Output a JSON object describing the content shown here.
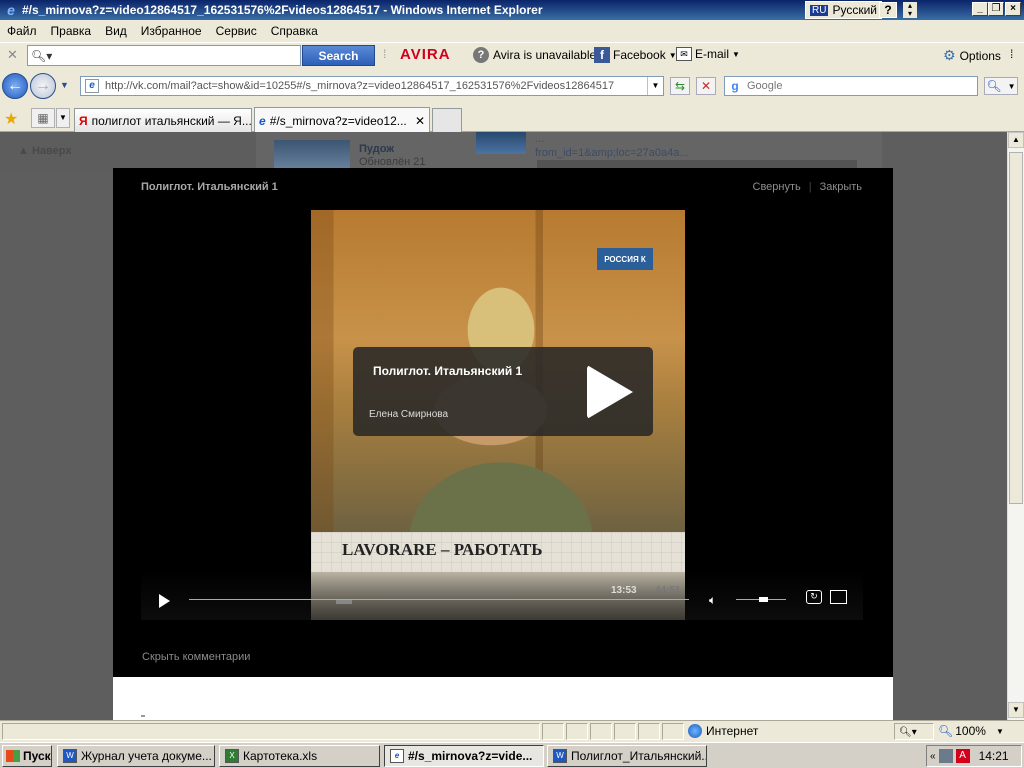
{
  "window": {
    "title": "#/s_mirnova?z=video12864517_162531576%2Fvideos12864517 - Windows Internet Explorer",
    "lang_code": "RU",
    "lang_name": "Русский"
  },
  "menu": [
    "Файл",
    "Правка",
    "Вид",
    "Избранное",
    "Сервис",
    "Справка"
  ],
  "search_toolbar": {
    "search_button": "Search",
    "avira_brand": "AVIRA",
    "avira_status": "Avira is unavailable",
    "facebook": "Facebook",
    "email": "E-mail",
    "options": "Options"
  },
  "address_bar": {
    "url": "http://vk.com/mail?act=show&id=10255#/s_mirnova?z=video12864517_162531576%2Fvideos12864517",
    "google_placeholder": "Google"
  },
  "tabs": [
    {
      "label": "полиглот итальянский — Я...",
      "active": false
    },
    {
      "label": "#/s_mirnova?z=video12...",
      "active": true
    }
  ],
  "background_page": {
    "up_link": "Наверх",
    "group_name": "Пудож",
    "group_updated": "Обновлён 21",
    "link_text_line1": "...",
    "link_text_line2": "from_id=1&amp;loc=27a0a4a..."
  },
  "video": {
    "title": "Полиглот. Итальянский 1",
    "minimize": "Свернуть",
    "close": "Закрыть",
    "channel_logo": "РОССИЯ К",
    "subtitle_text": "LAVORARE – РАБОТАТЬ",
    "info_title": "Полиглот. Итальянский 1",
    "info_author": "Елена Смирнова",
    "time_current": "13:53",
    "time_total": "44:51",
    "progress": 0.31,
    "volume": 0.55,
    "hide_comments": "Скрыть комментарии"
  },
  "status_bar": {
    "zone": "Интернет",
    "zoom": "100%"
  },
  "taskbar": {
    "start": "Пуск",
    "tasks": [
      {
        "label": "Журнал учета докуме...",
        "icon": "doc",
        "active": false
      },
      {
        "label": "Картотека.xls",
        "icon": "xls",
        "active": false
      },
      {
        "label": "#/s_mirnova?z=vide...",
        "icon": "ie",
        "active": true
      },
      {
        "label": "Полиглот_Итальянский...",
        "icon": "doc",
        "active": false
      }
    ],
    "clock": "14:21"
  }
}
